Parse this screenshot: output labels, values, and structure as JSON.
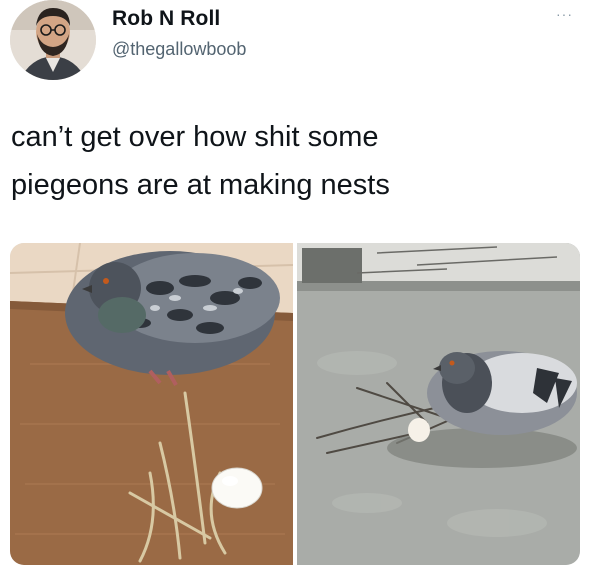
{
  "author": {
    "display_name": "Rob N Roll",
    "handle": "@thegallowboob",
    "avatar_icon": "avatar-bearded-man"
  },
  "more_menu": {
    "label": "···",
    "icon": "more-options-icon"
  },
  "tweet": {
    "text_line_1": "can’t get over how shit some",
    "text_line_2": "piegeons are at making nests"
  },
  "media": {
    "image_count": 2,
    "left_image_icon": "pigeon-on-doormat-photo",
    "right_image_icon": "pigeon-on-ground-photo"
  },
  "colors": {
    "text": "#0f1419",
    "secondary": "#536471",
    "background": "#ffffff"
  }
}
